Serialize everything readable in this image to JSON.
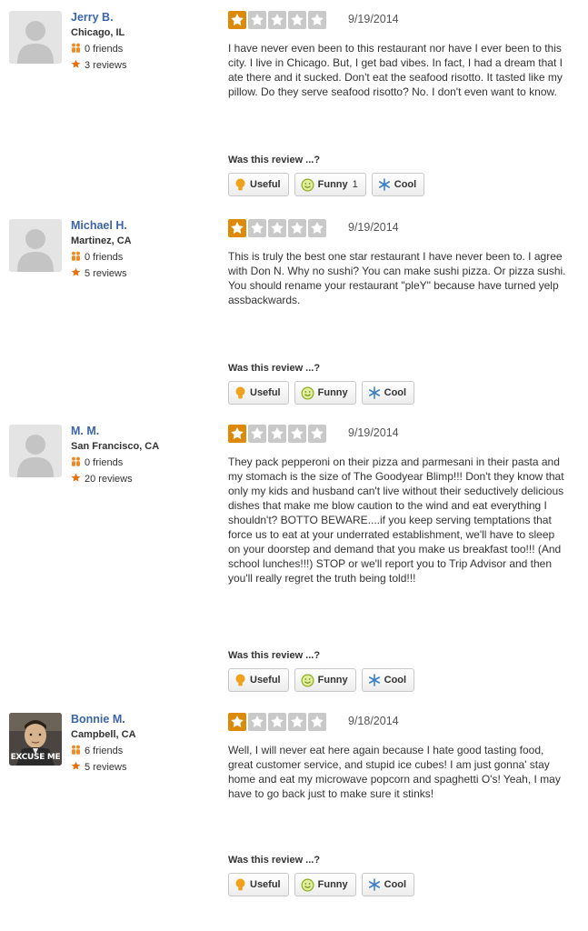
{
  "vote_prompt": "Was this review ...?",
  "vote_labels": {
    "useful": "Useful",
    "funny": "Funny",
    "cool": "Cool"
  },
  "colors": {
    "star_on": "#dd8a0a",
    "star_off": "#c9c9c9",
    "user_name": "#3b65a7"
  },
  "icons": {
    "friends": "friends-icon",
    "reviews": "star-icon",
    "useful": "lightbulb-icon",
    "funny": "smiley-icon",
    "cool": "snowflake-icon"
  },
  "reviews": [
    {
      "user": {
        "name": "Jerry B.",
        "location": "Chicago, IL",
        "friends": "0 friends",
        "reviews": "3 reviews",
        "avatar": "default-avatar"
      },
      "rating": 1,
      "date": "9/19/2014",
      "text": "I have never even been to this restaurant nor have I ever been to this city. I live in Chicago. But, I get bad vibes. In fact, I had a dream that I ate there and it sucked.  Don't eat the seafood risotto. It tasted like my pillow. Do they serve seafood risotto? No. I don't even want to know.",
      "votes": {
        "useful": "",
        "funny": "1",
        "cool": ""
      }
    },
    {
      "user": {
        "name": "Michael H.",
        "location": "Martinez, CA",
        "friends": "0 friends",
        "reviews": "5 reviews",
        "avatar": "default-avatar"
      },
      "rating": 1,
      "date": "9/19/2014",
      "text": "This is truly the best one star restaurant I have never been to. I agree with Don N. Why no sushi? You can make sushi pizza. Or pizza sushi. You should rename your restaurant \"pleY\" because have turned yelp assbackwards.",
      "votes": {
        "useful": "",
        "funny": "",
        "cool": ""
      }
    },
    {
      "user": {
        "name": "M. M.",
        "location": "San Francisco, CA",
        "friends": "0 friends",
        "reviews": "20 reviews",
        "avatar": "default-avatar"
      },
      "rating": 1,
      "date": "9/19/2014",
      "text": "They pack pepperoni on their pizza and  parmesani in their pasta and my stomach is the size of The Goodyear Blimp!!! Don't they know that only my kids and husband can't live without their seductively delicious dishes that make me blow caution to the wind and eat everything I shouldn't? BOTTO BEWARE....if you keep serving temptations that force us to eat at your underrated establishment, we'll have to sleep on your doorstep and demand that you make us breakfast too!!! (And school lunches!!!) STOP or we'll report you to Trip Advisor and then you'll really regret the truth being told!!!",
      "votes": {
        "useful": "",
        "funny": "",
        "cool": ""
      }
    },
    {
      "user": {
        "name": "Bonnie M.",
        "location": "Campbell, CA",
        "friends": "6 friends",
        "reviews": "5 reviews",
        "avatar": "photo-avatar",
        "avatar_caption": "EXCUSE ME"
      },
      "rating": 1,
      "date": "9/18/2014",
      "text": "Well, I will never eat here again because I hate good tasting food, great customer service, and stupid ice cubes! I am just gonna' stay home and eat my microwave popcorn and spaghetti O's!  Yeah, I may have to go back just to make sure it stinks!",
      "votes": {
        "useful": "",
        "funny": "",
        "cool": ""
      }
    }
  ]
}
